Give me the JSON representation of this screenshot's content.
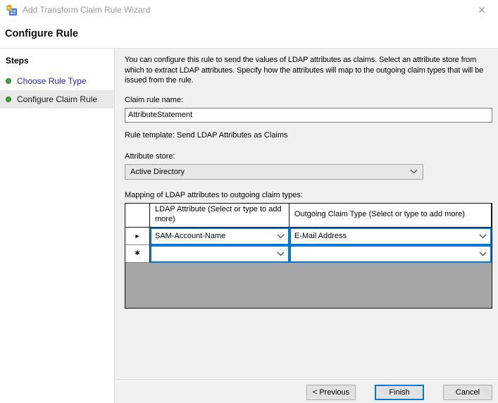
{
  "window": {
    "title": "Add Transform Claim Rule Wizard",
    "heading": "Configure Rule"
  },
  "icons": {
    "close": "✕",
    "app_icon": "claim-rule-wizard-icon",
    "chevron": "chevron-down"
  },
  "steps": {
    "header": "Steps",
    "items": [
      {
        "label": "Choose Rule Type",
        "state": "completed"
      },
      {
        "label": "Configure Claim Rule",
        "state": "current"
      }
    ]
  },
  "form": {
    "description": "You can configure this rule to send the values of LDAP attributes as claims. Select an attribute store from which to extract LDAP attributes. Specify how the attributes will map to the outgoing claim types that will be issued from the rule.",
    "claim_rule_name_label": "Claim rule name:",
    "claim_rule_name_value": "AttributeStatement",
    "rule_template": "Rule template: Send LDAP Attributes as Claims",
    "attribute_store_label": "Attribute store:",
    "attribute_store_value": "Active Directory",
    "mapping_label": "Mapping of LDAP attributes to outgoing claim types:"
  },
  "mapping_table": {
    "columns": [
      "LDAP Attribute (Select or type to add more)",
      "Outgoing Claim Type (Select or type to add more)"
    ],
    "rows": [
      {
        "marker": "►",
        "ldap_attribute": "SAM-Account-Name",
        "outgoing_claim_type": "E-Mail Address"
      },
      {
        "marker": "✱",
        "ldap_attribute": "",
        "outgoing_claim_type": ""
      }
    ]
  },
  "footer": {
    "previous": "< Previous",
    "finish": "Finish",
    "cancel": "Cancel"
  },
  "colors": {
    "accent_blue": "#0078d7",
    "step_link_blue": "#2222cc",
    "bullet_green": "#3fa33f",
    "grid_filler_gray": "#a6a6a6",
    "content_bg": "#f0f0f0"
  }
}
